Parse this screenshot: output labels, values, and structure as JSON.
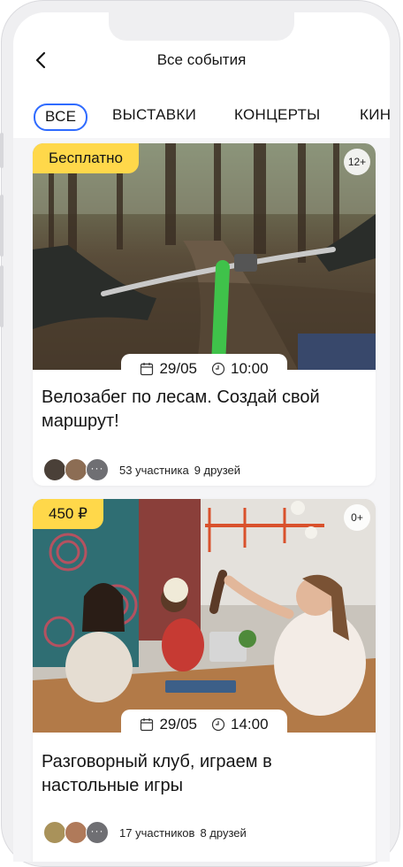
{
  "header": {
    "title": "Все события",
    "back_icon": "chevron-left-icon"
  },
  "tabs": [
    {
      "label": "ВСЕ",
      "active": true
    },
    {
      "label": "ВЫСТАВКИ",
      "active": false
    },
    {
      "label": "КОНЦЕРТЫ",
      "active": false
    },
    {
      "label": "КИНО",
      "active": false
    }
  ],
  "colors": {
    "accent": "#2f6bff",
    "badge": "#ffd84a",
    "background": "#f5f5f7"
  },
  "events": [
    {
      "price": "Бесплатно",
      "age": "12+",
      "date": "29/05",
      "time": "10:00",
      "title": "Велозабег по лесам. Создай свой маршрут!",
      "participants": "53 участника",
      "friends": "9 друзей",
      "date_icon": "calendar-icon",
      "time_icon": "clock-icon"
    },
    {
      "price": "450 ₽",
      "age": "0+",
      "date": "29/05",
      "time": "14:00",
      "title": "Разговорный клуб, играем в настольные игры",
      "participants": "17 участников",
      "friends": "8 друзей",
      "date_icon": "calendar-icon",
      "time_icon": "clock-icon"
    }
  ]
}
